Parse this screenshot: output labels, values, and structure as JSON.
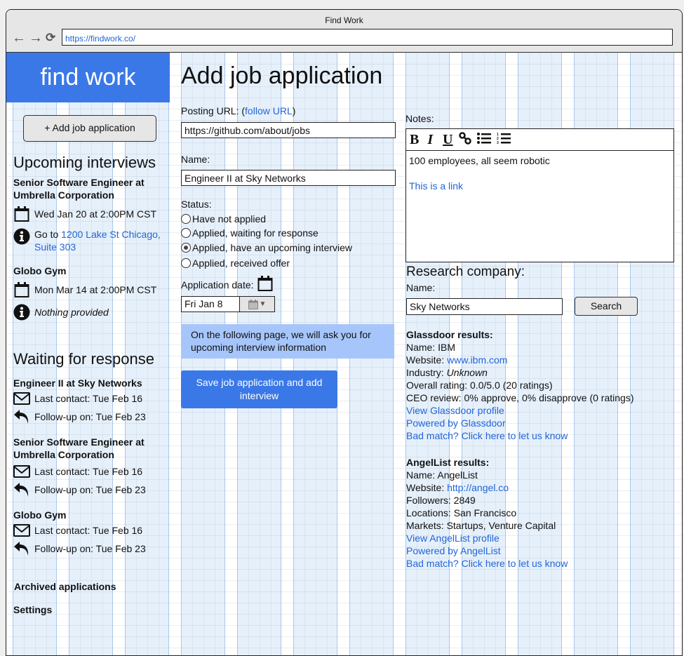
{
  "browser": {
    "title": "Find Work",
    "url": "https://findwork.co/",
    "back_icon": "←",
    "forward_icon": "→",
    "reload_icon": "⟳"
  },
  "sidebar": {
    "logo": "find work",
    "add_button": "+ Add job application",
    "upcoming_heading": "Upcoming interviews",
    "upcoming": [
      {
        "title": "Senior Software Engineer at Umbrella Corporation",
        "datetime": "Wed Jan 20 at 2:00PM CST",
        "location_prefix": "Go to ",
        "location_link": "1200 Lake St Chicago, Suite 303"
      },
      {
        "title": "Globo Gym",
        "datetime": "Mon Mar 14 at 2:00PM CST",
        "location_text": "Nothing provided"
      }
    ],
    "waiting_heading": "Waiting for response",
    "waiting": [
      {
        "title": "Engineer II at Sky Networks",
        "last_contact": "Last contact: Tue Feb 16",
        "follow_up": "Follow-up on: Tue Feb 23"
      },
      {
        "title": "Senior Software Engineer at Umbrella Corporation",
        "last_contact": "Last contact: Tue Feb 16",
        "follow_up": "Follow-up on: Tue Feb 23"
      },
      {
        "title": "Globo Gym",
        "last_contact": "Last contact: Tue Feb 16",
        "follow_up": "Follow-up on: Tue Feb 23"
      }
    ],
    "archived_link": "Archived applications",
    "settings_link": "Settings"
  },
  "form": {
    "heading": "Add job application",
    "posting_url_label": "Posting URL: (",
    "follow_url_link": "follow URL",
    "posting_url_close": ")",
    "posting_url_value": "https://github.com/about/jobs",
    "name_label": "Name:",
    "name_value": "Engineer II at Sky Networks",
    "status_label": "Status:",
    "status_options": [
      {
        "label": "Have not applied",
        "selected": false
      },
      {
        "label": "Applied, waiting for response",
        "selected": false
      },
      {
        "label": "Applied, have an upcoming interview",
        "selected": true
      },
      {
        "label": "Applied, received offer",
        "selected": false
      }
    ],
    "application_date_label": "Application date:",
    "application_date_value": "Fri Jan 8",
    "info_message": "On the following page, we will ask you for upcoming interview information",
    "save_button": "Save job application and add interview"
  },
  "notes": {
    "label": "Notes:",
    "toolbar": {
      "bold": "B",
      "italic": "I",
      "underline": "U"
    },
    "text": "100 employees, all seem robotic",
    "link_text": "This is a link"
  },
  "research": {
    "heading": "Research company:",
    "name_label": "Name:",
    "name_value": "Sky Networks",
    "search_button": "Search",
    "glassdoor": {
      "heading": "Glassdoor results:",
      "name": "Name: IBM",
      "website_label": "Website: ",
      "website_link": "www.ibm.com",
      "industry_label": "Industry: ",
      "industry_value": "Unknown",
      "rating": "Overall rating: 0.0/5.0 (20 ratings)",
      "ceo": "CEO review: 0% approve, 0% disapprove (0 ratings)",
      "profile_link": "View Glassdoor profile",
      "powered_link": "Powered by Glassdoor",
      "bad_match_link": "Bad match? Click here to let us know"
    },
    "angellist": {
      "heading": "AngelList results:",
      "name": "Name: AngelList",
      "website_label": "Website: ",
      "website_link": "http://angel.co",
      "followers": "Followers: 2849",
      "locations": "Locations: San Francisco",
      "markets": "Markets: Startups, Venture Capital",
      "profile_link": "View AngelList profile",
      "powered_link": "Powered by AngelList",
      "bad_match_link": "Bad match? Click here to let us know"
    }
  },
  "colors": {
    "brand": "#3b78e7",
    "link": "#2166d8",
    "info_bg": "#a6c6fb"
  }
}
